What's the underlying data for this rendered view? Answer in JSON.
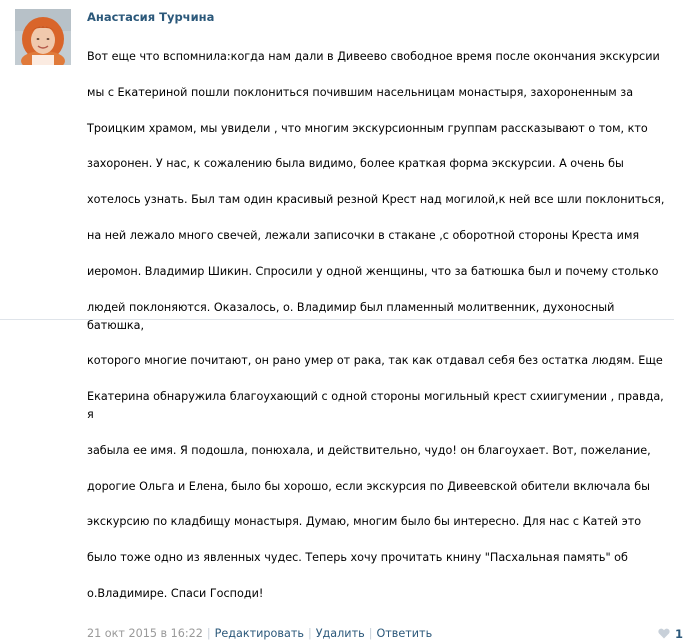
{
  "comment": {
    "author": "Анастасия Турчина",
    "text_lines": [
      "Вот еще что вспомнила:когда нам дали в Дивеево свободное время после окончания экскурсии",
      "мы с Екатериной пошли поклониться почившим насельницам монастыря, захороненным за",
      "Троицким храмом, мы увидели , что многим экскурсионным группам рассказывают о том, кто",
      "захоронен. У нас, к сожалению была видимо, более краткая форма экскурсии. А очень бы",
      "хотелось узнать. Был там один красивый резной Крест над могилой,к ней все шли поклониться,",
      "на ней лежало много свечей, лежали записочки в стакане ,с оборотной стороны Креста имя",
      "иеромон. Владимир Шикин. Спросили у одной женщины, что за батюшка был и почему столько",
      "людей поклоняются. Оказалось, о. Владимир был пламенный молитвенник, духоносный батюшка,",
      "которого многие почитают, он рано умер от рака, так как отдавал себя без остатка людям. Еще",
      "Екатерина обнаружила благоухающий с одной стороны могильный крест схиигумении , правда, я",
      "забыла ее имя. Я подошла, понюхала, и действительно, чудо! он благоухает. Вот, пожелание,",
      "дорогие Ольга и Елена, было бы хорошо, если экскурсия по Дивеевской обители включала бы",
      "экскурсию по кладбищу монастыря. Думаю, многим было бы интересно. Для нас с Катей это",
      "было тоже одно из явленных чудес. Теперь хочу прочитать книну \"Пасхальная память\" об",
      "о.Владимире. Спаси Господи!"
    ],
    "date": "21 окт 2015 в 16:22",
    "separator": "|",
    "actions": {
      "edit": "Редактировать",
      "delete": "Удалить",
      "reply": "Ответить"
    },
    "likes": {
      "count": "1",
      "icon": "heart-icon"
    }
  },
  "colors": {
    "link": "#2b587a",
    "meta": "#999999",
    "heart": "#c8d0d9",
    "divider": "#dfe4ea"
  }
}
